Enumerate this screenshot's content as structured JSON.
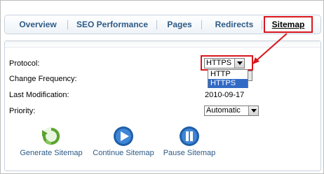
{
  "tabs": [
    {
      "label": "Overview"
    },
    {
      "label": "SEO Performance"
    },
    {
      "label": "Pages"
    },
    {
      "label": "Redirects"
    },
    {
      "label": "Sitemap",
      "active": true
    }
  ],
  "form": {
    "protocol": {
      "label": "Protocol:",
      "selected": "HTTPS",
      "options": [
        "HTTP",
        "HTTPS"
      ],
      "highlighted_option": "HTTPS"
    },
    "change_frequency": {
      "label": "Change Frequency:"
    },
    "last_modification": {
      "label": "Last Modification:",
      "value": "2010-09-17"
    },
    "priority": {
      "label": "Priority:",
      "selected": "Automatic"
    }
  },
  "actions": [
    {
      "label": "Generate Sitemap",
      "icon": "refresh-icon"
    },
    {
      "label": "Continue Sitemap",
      "icon": "play-icon"
    },
    {
      "label": "Pause Sitemap",
      "icon": "pause-icon"
    }
  ],
  "colors": {
    "annotation_red": "#d9161c",
    "tab_text": "#2d5a86",
    "selected_option_bg": "#316ac5",
    "refresh_green": "#5aa32e",
    "button_blue": "#1f5fa8"
  }
}
